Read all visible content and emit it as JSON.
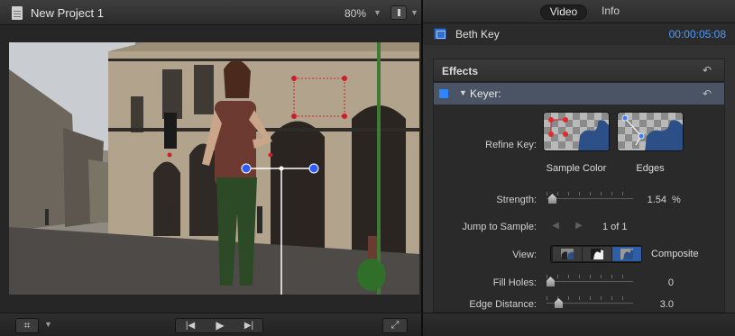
{
  "viewer": {
    "project_title": "New Project 1",
    "zoom_level": "80%",
    "zoom_menu_icon": "chevron-down-icon",
    "view_options_icon": "view-options-icon",
    "bottom": {
      "crop_icon": "crop-transform-icon",
      "prev_icon": "skip-back-icon",
      "play_icon": "play-icon",
      "next_icon": "skip-forward-icon",
      "fullscreen_icon": "fullscreen-icon",
      "prev_glyph": "|◀",
      "play_glyph": "▶",
      "next_glyph": "▶|",
      "fullscreen_glyph": "⤢",
      "crop_glyph": "⌗"
    }
  },
  "inspector": {
    "tabs": [
      {
        "label": "Video",
        "selected": true
      },
      {
        "label": "Info",
        "selected": false
      }
    ],
    "clip": {
      "name": "Beth Key",
      "timecode": "00:00:05:08"
    },
    "effects": {
      "section_title": "Effects",
      "reset_glyph": "↶",
      "keyer": {
        "label": "Keyer:",
        "enabled": true,
        "refine_key": {
          "label": "Refine Key:",
          "buttons": [
            {
              "caption": "Sample Color",
              "icon": "sample-color-icon"
            },
            {
              "caption": "Edges",
              "icon": "edges-icon"
            }
          ]
        },
        "strength": {
          "label": "Strength:",
          "value": "1.54",
          "unit": "%",
          "position": 0.02
        },
        "jump_to_sample": {
          "label": "Jump to Sample:",
          "count": "1 of 1"
        },
        "view": {
          "label": "View:",
          "mode": "Composite",
          "selected_index": 2
        },
        "fill_holes": {
          "label": "Fill Holes:",
          "value": "0",
          "position": 0.0
        },
        "edge_distance": {
          "label": "Edge Distance:",
          "value": "3.0",
          "position": 0.1
        }
      }
    }
  },
  "colors": {
    "accent": "#2f84ff",
    "timecode": "#4e9bff",
    "keyer_row": "#4a5464",
    "onscreen_control": "#2f5cff",
    "mask_points": "#c8202a"
  }
}
